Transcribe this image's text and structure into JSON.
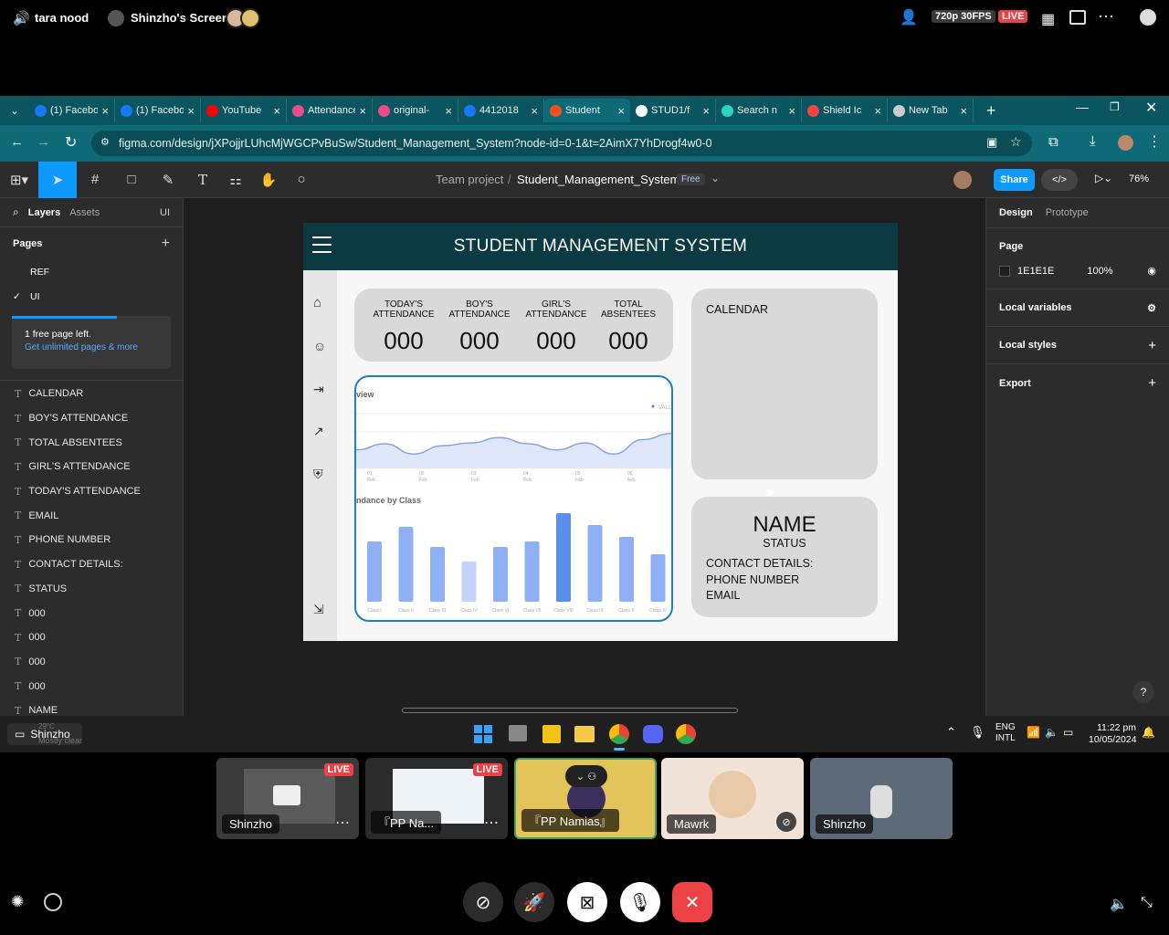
{
  "discord_top": {
    "user": "tara nood",
    "screen_label": "Shinzho's Screen",
    "quality": "720p 30FPS",
    "live": "LIVE"
  },
  "browser": {
    "tabs": [
      {
        "label": "(1) Facebook",
        "color": "#1877f2"
      },
      {
        "label": "(1) Facebook",
        "color": "#1877f2"
      },
      {
        "label": "YouTube",
        "color": "#ff0000"
      },
      {
        "label": "Attendance",
        "color": "#ea4c89"
      },
      {
        "label": "original-",
        "color": "#ea4c89"
      },
      {
        "label": "4412018",
        "color": "#1877f2"
      },
      {
        "label": "Student",
        "color": "#f24e1e"
      },
      {
        "label": "STUD1/f",
        "color": "#ffffff"
      },
      {
        "label": "Search n",
        "color": "#2dd4bf"
      },
      {
        "label": "Shield Ic",
        "color": "#ef4444"
      },
      {
        "label": "New Tab",
        "color": "#cccccc"
      }
    ],
    "url": "figma.com/design/jXPojjrLUhcMjWGCPvBuSw/Student_Management_System?node-id=0-1&t=2AimX7YhDrogf4w0-0"
  },
  "figma": {
    "breadcrumb_team": "Team project",
    "separator": "/",
    "file_name": "Student_Management_System",
    "plan_badge": "Free",
    "share": "Share",
    "zoom": "76%",
    "left": {
      "tab_layers": "Layers",
      "tab_assets": "Assets",
      "page_switch": "UI",
      "pages_title": "Pages",
      "pages": [
        {
          "name": "REF",
          "check": ""
        },
        {
          "name": "UI",
          "check": "✓"
        }
      ],
      "notice": "1 free page left.",
      "notice_link": "Get unlimited pages & more",
      "layers": [
        "CALENDAR",
        "BOY'S ATTENDANCE",
        "TOTAL ABSENTEES",
        "GIRL'S ATTENDANCE",
        "TODAY'S ATTENDANCE",
        "EMAIL",
        "PHONE NUMBER",
        "CONTACT DETAILS:",
        "STATUS",
        "000",
        "000",
        "000",
        "000",
        "NAME"
      ]
    },
    "right": {
      "tab_design": "Design",
      "tab_prototype": "Prototype",
      "page_section": "Page",
      "page_color": "1E1E1E",
      "page_opacity": "100%",
      "local_variables": "Local variables",
      "local_styles": "Local styles",
      "export": "Export",
      "help": "?"
    },
    "design": {
      "header_title": "STUDENT MANAGEMENT SYSTEM",
      "stats": [
        {
          "label": "TODAY'S ATTENDANCE",
          "value": "000"
        },
        {
          "label": "BOY'S ATTENDANCE",
          "value": "000"
        },
        {
          "label": "GIRL'S ATTENDANCE",
          "value": "000"
        },
        {
          "label": "TOTAL ABSENTEES",
          "value": "000"
        }
      ],
      "calendar": "CALENDAR",
      "profile": {
        "name": "NAME",
        "status": "STATUS",
        "contact": "CONTACT DETAILS:",
        "phone": "PHONE NUMBER",
        "email": "EMAIL"
      },
      "chart_overview_title": "view",
      "chart_legend": "VALUE",
      "chart_x_labels": [
        "01 Feb",
        "02 Feb",
        "03 Feb",
        "04 Feb",
        "05 Feb",
        "06 Feb"
      ],
      "chart_bar_title": "ndance by Class",
      "chart_data": {
        "type": "bar",
        "categories": [
          "Class I",
          "Class II",
          "Class III",
          "Class IV",
          "Class VI",
          "Class VII",
          "Class VIII",
          "Class IX",
          "Class X",
          "Class XI"
        ],
        "values": [
          66,
          82,
          60,
          44,
          60,
          66,
          97,
          84,
          71,
          52
        ],
        "ylim": [
          0,
          100
        ]
      },
      "chart_line": [
        0.45,
        0.6,
        0.35,
        0.55,
        0.62,
        0.75,
        0.6,
        0.45,
        0.62,
        0.35,
        0.7,
        0.85
      ]
    }
  },
  "taskbar": {
    "weather_temp": "29°C",
    "weather_desc": "Mostly clear",
    "lang1": "ENG",
    "lang2": "INTL",
    "time": "11:22 pm",
    "date": "10/05/2024",
    "user_tag": "Shinzho"
  },
  "discord_bottom": {
    "tiles": [
      {
        "label": "Shinzho",
        "live": "LIVE"
      },
      {
        "label": "『PP Na...",
        "live": "LIVE"
      },
      {
        "label": "『PP Namias』"
      },
      {
        "label": "Mawrk"
      },
      {
        "label": "Shinzho"
      }
    ]
  }
}
